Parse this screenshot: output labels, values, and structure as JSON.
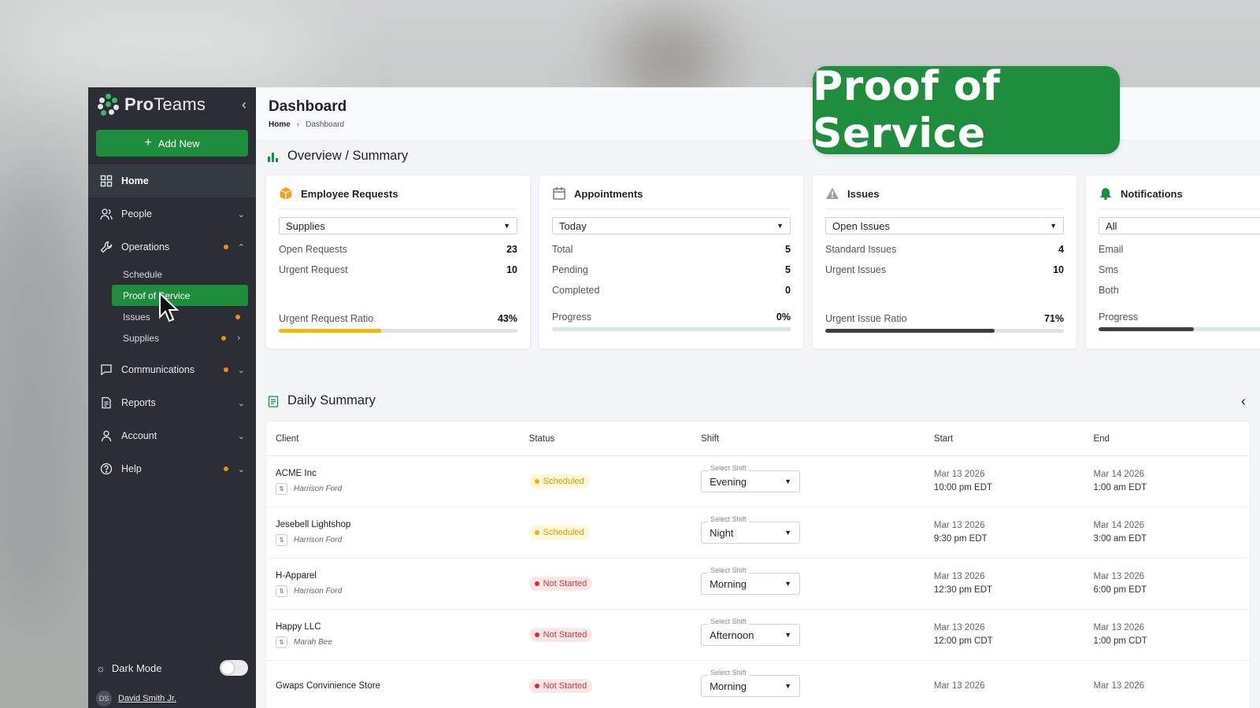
{
  "brand": {
    "name_bold": "Pro",
    "name_rest": "Teams"
  },
  "sidebar": {
    "add_new": "Add New",
    "items": [
      {
        "label": "Home"
      },
      {
        "label": "People"
      },
      {
        "label": "Operations"
      },
      {
        "label": "Communications"
      },
      {
        "label": "Reports"
      },
      {
        "label": "Account"
      },
      {
        "label": "Help"
      }
    ],
    "operations_sub": [
      {
        "label": "Schedule"
      },
      {
        "label": "Proof of Service"
      },
      {
        "label": "Issues"
      },
      {
        "label": "Supplies"
      }
    ],
    "dark_mode": "Dark Mode",
    "user": {
      "initials": "DS",
      "name": "David Smith Jr."
    }
  },
  "header": {
    "title": "Dashboard",
    "breadcrumb": [
      "Home",
      "Dashboard"
    ]
  },
  "overview": {
    "title": "Overview / Summary",
    "cards": [
      {
        "title": "Employee Requests",
        "filter": "Supplies",
        "rows": [
          {
            "label": "Open Requests",
            "value": "23"
          },
          {
            "label": "Urgent Request",
            "value": "10"
          }
        ],
        "progress_label": "Urgent Request Ratio",
        "progress_value": "43%",
        "progress_fraction": 0.43,
        "progress_color": "#f5b800"
      },
      {
        "title": "Appointments",
        "filter": "Today",
        "rows": [
          {
            "label": "Total",
            "value": "5"
          },
          {
            "label": "Pending",
            "value": "5"
          },
          {
            "label": "Completed",
            "value": "0"
          }
        ],
        "progress_label": "Progress",
        "progress_value": "0%",
        "progress_fraction": 0,
        "progress_color": "#1e8e3e"
      },
      {
        "title": "Issues",
        "filter": "Open Issues",
        "rows": [
          {
            "label": "Standard Issues",
            "value": "4"
          },
          {
            "label": "Urgent Issues",
            "value": "10"
          }
        ],
        "progress_label": "Urgent Issue Ratio",
        "progress_value": "71%",
        "progress_fraction": 0.71,
        "progress_color": "#3a3f44"
      },
      {
        "title": "Notifications",
        "filter": "All",
        "rows": [
          {
            "label": "Email",
            "value": ""
          },
          {
            "label": "Sms",
            "value": ""
          },
          {
            "label": "Both",
            "value": ""
          }
        ],
        "progress_label": "Progress",
        "progress_value": "",
        "progress_fraction": 0.4,
        "progress_color": "#3a3f44"
      }
    ]
  },
  "daily": {
    "title": "Daily Summary",
    "columns": [
      "Client",
      "Status",
      "Shift",
      "Start",
      "End"
    ],
    "shift_label": "Select Shift",
    "rows": [
      {
        "client": "ACME Inc",
        "employee": "Harrison Ford",
        "status": "Scheduled",
        "status_kind": "sched",
        "shift": "Evening",
        "start_date": "Mar 13 2026",
        "start_time": "10:00 pm EDT",
        "end_date": "Mar 14 2026",
        "end_time": "1:00 am EDT"
      },
      {
        "client": "Jesebell Lightshop",
        "employee": "Harrison Ford",
        "status": "Scheduled",
        "status_kind": "sched",
        "shift": "Night",
        "start_date": "Mar 13 2026",
        "start_time": "9:30 pm EDT",
        "end_date": "Mar 14 2026",
        "end_time": "3:00 am EDT"
      },
      {
        "client": "H-Apparel",
        "employee": "Harrison Ford",
        "status": "Not Started",
        "status_kind": "ns",
        "shift": "Morning",
        "start_date": "Mar 13 2026",
        "start_time": "12:30 pm EDT",
        "end_date": "Mar 13 2026",
        "end_time": "6:00 pm EDT"
      },
      {
        "client": "Happy LLC",
        "employee": "Marah Bee",
        "status": "Not Started",
        "status_kind": "ns",
        "shift": "Afternoon",
        "start_date": "Mar 13 2026",
        "start_time": "12:00 pm CDT",
        "end_date": "Mar 13 2026",
        "end_time": "1:00 pm CDT"
      },
      {
        "client": "Gwaps Convinience Store",
        "employee": "",
        "status": "Not Started",
        "status_kind": "ns",
        "shift": "Morning",
        "start_date": "Mar 13 2026",
        "start_time": "",
        "end_date": "Mar 13 2026",
        "end_time": ""
      }
    ]
  },
  "banner": {
    "text": "Proof of Service"
  },
  "colors": {
    "accent": "#1e8e3e",
    "sidebar_bg": "#2b2f35",
    "warning_dot": "#f08a1c"
  }
}
